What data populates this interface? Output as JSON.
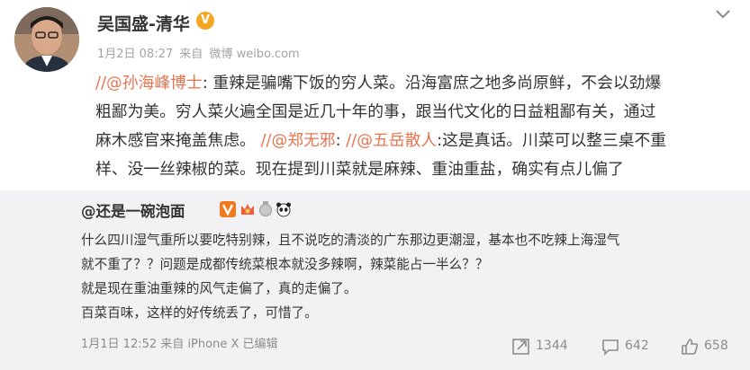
{
  "post": {
    "author": "吴国盛-清华",
    "verified_badge": "V",
    "meta": {
      "date": "1月2日 08:27",
      "source_prefix": "来自",
      "source": "微博 weibo.com"
    },
    "content": [
      [
        {
          "t": "//",
          "c": "slash"
        },
        {
          "t": "@孙海峰博士",
          "c": "mention"
        },
        {
          "t": ": 重辣是骗嘴下饭的穷人菜。沿海富庶之地多尚原鲜，不会以劲爆",
          "c": ""
        }
      ],
      [
        {
          "t": "粗鄙为美。穷人菜火遍全国是近几十年的事，跟当代文化的日益粗鄙有关，通过",
          "c": ""
        }
      ],
      [
        {
          "t": "麻木感官来掩盖焦虑。 ",
          "c": ""
        },
        {
          "t": "//",
          "c": "slash"
        },
        {
          "t": "@郑无邪",
          "c": "mention"
        },
        {
          "t": ": ",
          "c": ""
        },
        {
          "t": "//",
          "c": "slash"
        },
        {
          "t": "@五岳散人",
          "c": "mention"
        },
        {
          "t": ":这是真话。川菜可以整三桌不重",
          "c": ""
        }
      ],
      [
        {
          "t": "样、没一丝辣椒的菜。现在提到川菜就是麻辣、重油重盐，确实有点儿偏了",
          "c": ""
        }
      ]
    ]
  },
  "repost": {
    "author": "@还是一碗泡面",
    "badges": [
      "V-badge-icon",
      "crown-icon",
      "medal-icon",
      "panda-icon"
    ],
    "lines": [
      "什么四川湿气重所以要吃特别辣，且不说吃的清淡的广东那边更潮湿，基本也不吃辣上海湿气",
      "就不重了？？问题是成都传统菜根本就没多辣啊，辣菜能占一半么？？",
      "就是现在重油重辣的风气走偏了，真的走偏了。",
      "百菜百味，这样的好传统丢了，可惜了。"
    ],
    "meta": {
      "date": "1月1日 12:52",
      "source_prefix": "来自",
      "source": "iPhone X",
      "edited": "已编辑"
    },
    "stats": {
      "reposts": "1344",
      "comments": "642",
      "likes": "658"
    }
  },
  "colors": {
    "mention": "#eb7350",
    "verified": "#f5a623",
    "repost_bg": "#f2f2f5"
  }
}
